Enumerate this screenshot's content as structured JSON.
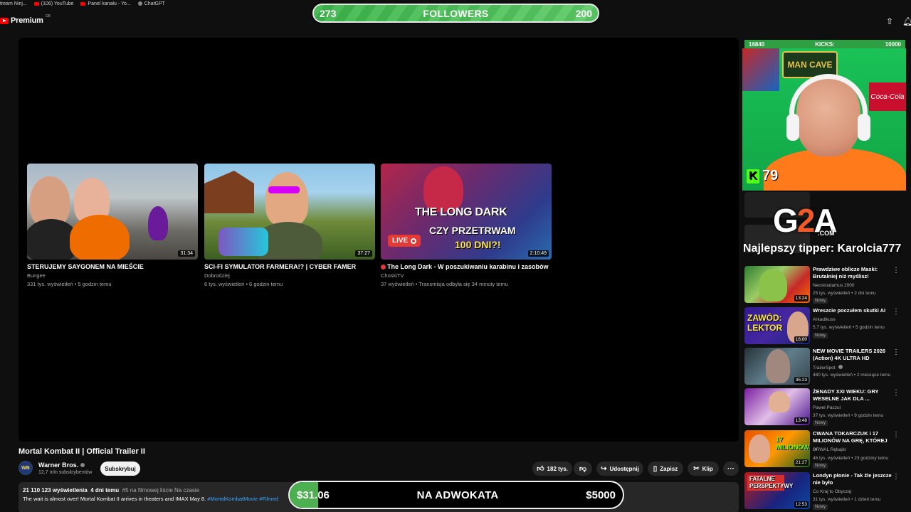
{
  "bookmarks": [
    {
      "label": "tream Ninj..."
    },
    {
      "label": "(106) YouTube"
    },
    {
      "label": "Panel kanału - Yo..."
    },
    {
      "label": "ChatGPT"
    }
  ],
  "header": {
    "logo": "Premium",
    "logo_sup": "GB"
  },
  "followers_goal": {
    "current": "273",
    "label": "FOLLOWERS",
    "target": "200",
    "color": "#4caf50"
  },
  "end_screen": [
    {
      "title": "STERUJEMY SAYGONEM NA MIEŚCIE",
      "channel": "Bungee",
      "meta": "331 tys. wyświetleń • 5 godzin temu",
      "duration": "31:34"
    },
    {
      "title": "SCI-FI SYMULATOR FARMERA!? | CYBER FAMER",
      "channel": "Dobrodziej",
      "meta": "6 tys. wyświetleń • 6 godzin temu",
      "duration": "37:27"
    },
    {
      "title": "The Long Dark - W poszukiwaniu karabinu i zasobów",
      "channel": "ChoskiTV",
      "meta": "37 wyświetleń • Transmisja odbyła się 34 minuty temu",
      "duration": "2:10:49",
      "thumb_title": "THE LONG DARK",
      "thumb_sub": "CZY PRZETRWAM",
      "thumb_sub2": "100 DNI?!",
      "live": "LIVE"
    }
  ],
  "video": {
    "title": "Mortal Kombat II | Official Trailer II",
    "channel": "Warner Bros.",
    "avatar": "WB",
    "subs": "12,7 mln subskrybentów",
    "subscribe": "Subskrybuj",
    "likes": "182 tys.",
    "share": "Udostępnij",
    "save": "Zapisz",
    "clip": "Klip",
    "views": "21 110 123 wyświetlenia",
    "age": "4 dni temu",
    "trending": "#5 na filmowej liście Na czasie",
    "desc_text": "The wait is almost over! Mortal Kombat II arrives in theaters and IMAX May 8.",
    "desc_tags": "#MortalKombatMovie #Filmed"
  },
  "donation_goal": {
    "current": "$31.06",
    "label": "NA ADWOKATA",
    "target": "$5000",
    "progress": 0.0062
  },
  "webcam": {
    "left_stat": "16840",
    "kicks_label": "KICKS:",
    "right_stat": "10000",
    "kick_count": "79",
    "sign": "MAN CAVE",
    "coke": "Coca-Cola"
  },
  "sponsor": {
    "g2a": "G2A",
    "g2a_com": ".COM"
  },
  "tipper": "Najlepszy tipper: Karolcia777",
  "recommendations": [
    {
      "title": "Prawdziwe oblicze Maski: Brutalniej niż myślisz!",
      "channel": "Neostradamus 2000",
      "meta": "25 tys. wyświetleń • 2 dni temu",
      "badge": "Nowy",
      "duration": "13:24"
    },
    {
      "title": "Wreszcie poczułem skutki AI",
      "channel": "Arkadikuss",
      "meta": "5,7 tys. wyświetleń • 5 godzin temu",
      "badge": "Nowy",
      "duration": "16:00",
      "thumb_text": "ZAWÓD: LEKTOR"
    },
    {
      "title": "NEW MOVIE TRAILERS 2026 (Action) 4K ULTRA HD",
      "channel": "TrailerSpot",
      "meta": "480 tys. wyświetleń • 2 miesiące temu",
      "badge": "",
      "duration": "35:23"
    },
    {
      "title": "ŻENADY XXI WIEKU: GRY WESELNE JAK DLA ...",
      "channel": "Paweł Paczul",
      "meta": "37 tys. wyświetleń • 9 godzin temu",
      "badge": "Nowy",
      "duration": "13:48"
    },
    {
      "title": "CWANA TOKARCZUK i 17 MILIONÓW NA GRĘ, KTÓREJ ...",
      "channel": "DRWAL Rębajło",
      "meta": "46 tys. wyświetleń • 23 godziny temu",
      "badge": "Nowy",
      "duration": "21:27",
      "thumb_text": "17 MILIONÓW"
    },
    {
      "title": "Londyn płonie - Tak źle jeszcze nie było",
      "channel": "Co Kraj to Obyczaj",
      "meta": "31 tys. wyświetleń • 1 dzień temu",
      "badge": "Nowy",
      "duration": "12:53",
      "thumb_text": "FATALNE PERSPEKTYWY"
    }
  ]
}
